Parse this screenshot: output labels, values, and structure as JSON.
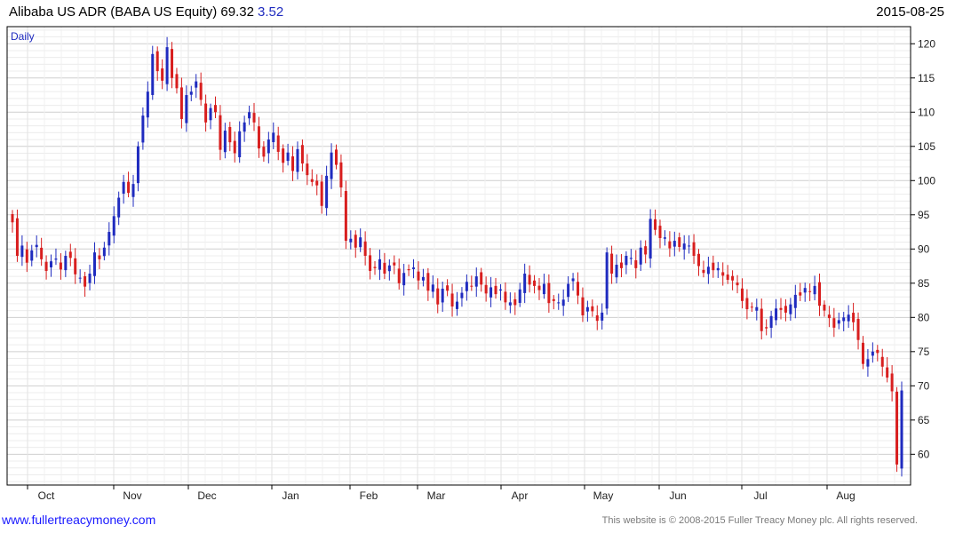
{
  "header": {
    "title": "Alibaba US ADR (BABA US Equity) 69.32",
    "change": "3.52",
    "date": "2015-08-25"
  },
  "footer": {
    "site": "www.fullertreacymoney.com",
    "copyright": "This website is © 2008-2015 Fuller Treacy Money plc. All rights reserved."
  },
  "colors": {
    "up": "#1f2bbf",
    "down": "#d81e1e",
    "grid": "#dcdcdc",
    "frame": "#000000"
  },
  "chart_data": {
    "type": "ohlc-candlestick",
    "period_label": "Daily",
    "x_tick_labels": [
      "Oct",
      "Nov",
      "Dec",
      "Jan",
      "Feb",
      "Mar",
      "Apr",
      "May",
      "Jun",
      "Jul",
      "Aug"
    ],
    "y_tick_labels": [
      60,
      65,
      70,
      75,
      80,
      85,
      90,
      95,
      100,
      105,
      110,
      115,
      120
    ],
    "ylim": [
      55.5,
      122.5
    ],
    "grid": true,
    "y_axis_side": "right",
    "closes": [
      93.9,
      89.0,
      90.5,
      88.0,
      89.8,
      90.6,
      88.5,
      86.8,
      88.2,
      88.6,
      87.0,
      89.0,
      88.7,
      86.3,
      85.8,
      84.5,
      86.4,
      89.5,
      88.5,
      90.2,
      92.5,
      94.8,
      97.5,
      99.8,
      98.2,
      99.5,
      105.0,
      109.5,
      113.0,
      118.5,
      116.0,
      114.6,
      119.5,
      115.0,
      113.5,
      109.0,
      112.5,
      113.0,
      114.5,
      111.8,
      108.5,
      110.6,
      110.0,
      104.5,
      107.3,
      105.6,
      104.0,
      107.2,
      108.5,
      110.0,
      108.5,
      104.7,
      103.5,
      106.0,
      107.0,
      104.2,
      102.6,
      104.1,
      101.4,
      104.6,
      102.5,
      100.8,
      99.8,
      99.3,
      96.3,
      100.7,
      104.1,
      102.3,
      99.0,
      91.2,
      91.5,
      90.2,
      91.7,
      89.0,
      86.8,
      87.2,
      88.5,
      86.4,
      87.6,
      87.6,
      85.0,
      86.5,
      86.9,
      87.3,
      85.4,
      85.9,
      83.9,
      84.8,
      81.9,
      84.2,
      83.9,
      81.6,
      82.3,
      83.6,
      85.2,
      84.6,
      86.0,
      84.8,
      83.5,
      84.4,
      83.4,
      84.1,
      82.2,
      82.2,
      81.8,
      84.1,
      86.4,
      84.8,
      84.6,
      84.0,
      84.9,
      82.1,
      82.4,
      82.2,
      82.6,
      84.9,
      85.7,
      83.2,
      80.3,
      81.5,
      80.9,
      79.5,
      80.7,
      89.5,
      86.4,
      87.7,
      87.2,
      89.0,
      88.7,
      87.2,
      90.2,
      89.2,
      94.4,
      92.8,
      91.6,
      91.7,
      90.1,
      91.2,
      90.3,
      90.8,
      90.5,
      89.0,
      87.5,
      86.5,
      87.4,
      86.9,
      87.2,
      86.1,
      85.5,
      85.4,
      84.7,
      82.4,
      81.2,
      81.5,
      81.5,
      78.0,
      78.4,
      80.2,
      81.3,
      81.1,
      80.7,
      81.9,
      83.3,
      83.2,
      84.3,
      83.7,
      84.6,
      81.7,
      81.0,
      79.9,
      78.5,
      79.6,
      80.0,
      80.4,
      79.3,
      76.7,
      73.2,
      73.9,
      75.0,
      74.8,
      72.8,
      71.2,
      69.2,
      58.5,
      69.32
    ],
    "note": "Each session drawn as an OHLC candle: red = decline, blue = advance."
  }
}
